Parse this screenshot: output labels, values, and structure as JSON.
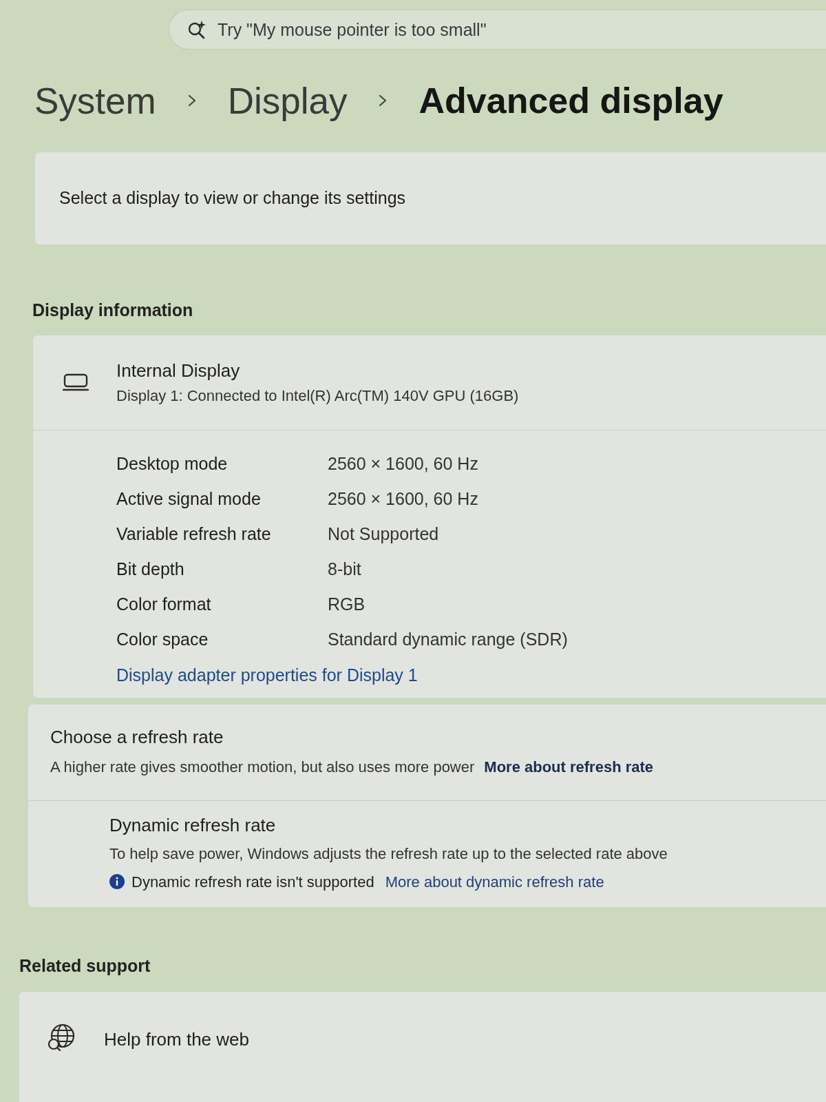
{
  "search": {
    "placeholder": "Try \"My mouse pointer is too small\""
  },
  "breadcrumb": [
    {
      "label": "System",
      "current": false
    },
    {
      "label": "Display",
      "current": false
    },
    {
      "label": "Advanced display",
      "current": true
    }
  ],
  "display_select": {
    "label": "Select a display to view or change its settings"
  },
  "display_information": {
    "heading": "Display information",
    "display": {
      "name": "Internal Display",
      "description": "Display 1: Connected to Intel(R) Arc(TM) 140V GPU (16GB)"
    },
    "properties": [
      {
        "label": "Desktop mode",
        "value": "2560 × 1600, 60 Hz"
      },
      {
        "label": "Active signal mode",
        "value": "2560 × 1600, 60 Hz"
      },
      {
        "label": "Variable refresh rate",
        "value": "Not Supported"
      },
      {
        "label": "Bit depth",
        "value": "8-bit"
      },
      {
        "label": "Color format",
        "value": "RGB"
      },
      {
        "label": "Color space",
        "value": "Standard dynamic range (SDR)"
      }
    ],
    "link": "Display adapter properties for Display 1"
  },
  "refresh_rate": {
    "title": "Choose a refresh rate",
    "description": "A higher rate gives smoother motion, but also uses more power",
    "link": "More about refresh rate",
    "dynamic": {
      "title": "Dynamic refresh rate",
      "description": "To help save power, Windows adjusts the refresh rate up to the selected rate above",
      "notice": "Dynamic refresh rate isn't supported",
      "link": "More about dynamic refresh rate"
    }
  },
  "related_support": {
    "heading": "Related support",
    "items": [
      {
        "label": "Help from the web"
      }
    ]
  }
}
